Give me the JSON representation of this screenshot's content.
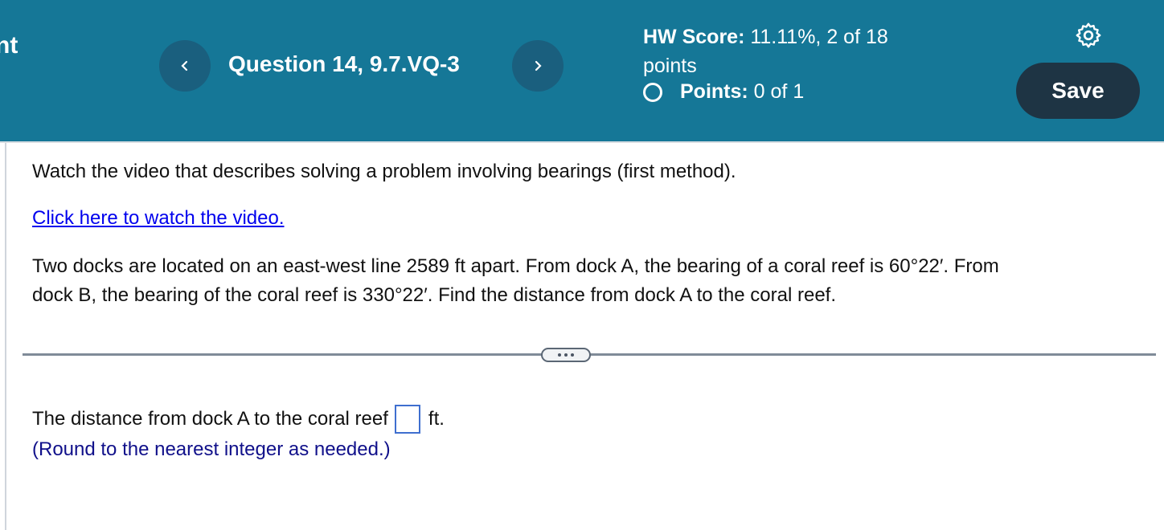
{
  "header": {
    "title_fragment": "nt",
    "question_title": "Question 14, 9.7.VQ-3",
    "hw_score_label": "HW Score:",
    "hw_score_value": " 11.11%, 2 of 18",
    "hw_score_cont": "points",
    "points_label": "Points:",
    "points_value": " 0 of 1",
    "save_label": "Save",
    "icons": {
      "prev": "chevron-left-icon",
      "next": "chevron-right-icon",
      "settings": "gear-icon",
      "status": "circle-outline-icon"
    }
  },
  "content": {
    "instruction": "Watch the video that describes solving a problem involving bearings (first method).",
    "video_link": "Click here to watch the video.",
    "problem_line1": "Two docks are located on an east-west line 2589 ft apart. From dock A, the bearing of a coral reef is 60°22′. From",
    "problem_line2": "dock B, the bearing of the coral reef is 330°22′. Find the distance from dock A to the coral reef.",
    "answer_prefix": "The distance from dock A to the coral reef",
    "answer_value": "",
    "answer_unit": "ft.",
    "hint": "(Round to the nearest integer as needed.)"
  },
  "colors": {
    "header_bg": "#157797",
    "save_bg": "#1e3444",
    "link": "#0000ee",
    "hint": "#10108a"
  }
}
